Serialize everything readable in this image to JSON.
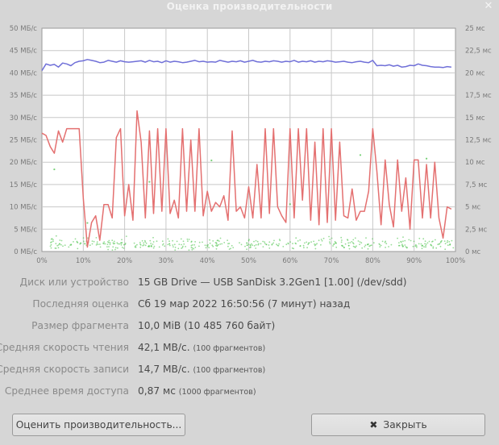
{
  "window": {
    "title": "Оценка производительности",
    "close_glyph": "✕"
  },
  "chart_data": {
    "type": "line",
    "x_ticks": [
      "0%",
      "10%",
      "20%",
      "30%",
      "40%",
      "50%",
      "60%",
      "70%",
      "80%",
      "90%",
      "100%"
    ],
    "y_left_ticks": [
      "0 МБ/с",
      "5 МБ/с",
      "10 МБ/с",
      "15 МБ/с",
      "20 МБ/с",
      "25 МБ/с",
      "30 МБ/с",
      "35 МБ/с",
      "40 МБ/с",
      "45 МБ/с",
      "50 МБ/с"
    ],
    "y_right_ticks": [
      "0 мс",
      "2,5 мс",
      "5 мс",
      "7,5 мс",
      "10 мс",
      "12,5 мс",
      "15 мс",
      "17,5 мс",
      "20 мс",
      "22,5 мс",
      "25 мс"
    ],
    "x_range": [
      0,
      100
    ],
    "y_left_range": [
      0,
      50
    ],
    "y_right_range": [
      0,
      25
    ],
    "grid": true,
    "colors": {
      "read": "#7070d8",
      "write": "#e47070",
      "access": "#3fbf3f",
      "grid": "#c8c8c8",
      "plot_bg": "#ffffff"
    },
    "series": [
      {
        "key": "read",
        "x": [
          0,
          1,
          2,
          3,
          4,
          5,
          6,
          7,
          8,
          9,
          10,
          11,
          12,
          13,
          14,
          15,
          16,
          17,
          18,
          19,
          20,
          21,
          22,
          23,
          24,
          25,
          26,
          27,
          28,
          29,
          30,
          31,
          32,
          33,
          34,
          35,
          36,
          37,
          38,
          39,
          40,
          41,
          42,
          43,
          44,
          45,
          46,
          47,
          48,
          49,
          50,
          51,
          52,
          53,
          54,
          55,
          56,
          57,
          58,
          59,
          60,
          61,
          62,
          63,
          64,
          65,
          66,
          67,
          68,
          69,
          70,
          71,
          72,
          73,
          74,
          75,
          76,
          77,
          78,
          79,
          80,
          81,
          82,
          83,
          84,
          85,
          86,
          87,
          88,
          89,
          90,
          91,
          92,
          93,
          94,
          95,
          96,
          97,
          98,
          99
        ],
        "values": [
          40.5,
          42.0,
          41.7,
          41.9,
          41.3,
          42.2,
          42.0,
          41.6,
          42.3,
          42.6,
          42.7,
          43.0,
          42.8,
          42.6,
          42.3,
          42.4,
          42.8,
          42.6,
          42.4,
          42.7,
          42.5,
          42.4,
          42.5,
          42.6,
          42.7,
          42.4,
          42.8,
          42.5,
          42.6,
          42.3,
          42.7,
          42.4,
          42.6,
          42.5,
          42.3,
          42.4,
          42.6,
          42.8,
          42.5,
          42.6,
          42.4,
          42.5,
          42.4,
          42.8,
          42.6,
          42.4,
          42.6,
          42.5,
          42.7,
          42.4,
          42.6,
          42.8,
          42.5,
          42.4,
          42.6,
          42.5,
          42.7,
          42.6,
          42.4,
          42.6,
          42.5,
          42.8,
          42.4,
          42.6,
          42.5,
          42.7,
          42.4,
          42.6,
          42.5,
          42.7,
          42.6,
          42.4,
          42.5,
          42.6,
          42.4,
          42.3,
          42.5,
          42.6,
          42.4,
          42.3,
          42.8,
          41.6,
          41.7,
          41.6,
          41.8,
          41.5,
          41.7,
          41.3,
          41.4,
          41.7,
          41.6,
          42.0,
          41.7,
          41.6,
          41.4,
          41.3,
          41.3,
          41.2,
          41.4,
          41.3
        ]
      },
      {
        "key": "write",
        "x": [
          0,
          1,
          2,
          3,
          4,
          5,
          6,
          7,
          8,
          9,
          10,
          11,
          12,
          13,
          14,
          15,
          16,
          17,
          18,
          19,
          20,
          21,
          22,
          23,
          24,
          25,
          26,
          27,
          28,
          29,
          30,
          31,
          32,
          33,
          34,
          35,
          36,
          37,
          38,
          39,
          40,
          41,
          42,
          43,
          44,
          45,
          46,
          47,
          48,
          49,
          50,
          51,
          52,
          53,
          54,
          55,
          56,
          57,
          58,
          59,
          60,
          61,
          62,
          63,
          64,
          65,
          66,
          67,
          68,
          69,
          70,
          71,
          72,
          73,
          74,
          75,
          76,
          77,
          78,
          79,
          80,
          81,
          82,
          83,
          84,
          85,
          86,
          87,
          88,
          89,
          90,
          91,
          92,
          93,
          94,
          95,
          96,
          97,
          98,
          99
        ],
        "values": [
          26.5,
          26.0,
          23.5,
          22.0,
          27.0,
          24.5,
          27.5,
          27.5,
          27.5,
          27.5,
          12.0,
          1.0,
          6.5,
          8.0,
          2.5,
          10.5,
          10.5,
          7.5,
          25.5,
          27.5,
          8.0,
          15.0,
          7.0,
          31.5,
          24.5,
          7.5,
          27.0,
          8.5,
          27.5,
          9.0,
          27.5,
          8.5,
          11.5,
          7.5,
          27.5,
          9.0,
          25.0,
          9.0,
          27.5,
          8.0,
          13.5,
          9.0,
          11.0,
          10.0,
          12.5,
          7.0,
          27.0,
          9.0,
          10.0,
          7.5,
          14.5,
          7.5,
          19.5,
          7.5,
          27.5,
          8.5,
          27.5,
          10.0,
          8.0,
          6.5,
          27.5,
          7.5,
          27.5,
          11.5,
          27.5,
          7.0,
          24.5,
          6.0,
          27.5,
          6.5,
          27.5,
          7.0,
          24.5,
          8.0,
          7.5,
          14.0,
          7.0,
          9.0,
          9.0,
          13.5,
          27.5,
          18.0,
          6.0,
          20.5,
          10.5,
          5.5,
          20.5,
          9.0,
          16.5,
          5.0,
          20.5,
          20.5,
          7.5,
          19.5,
          7.5,
          20.0,
          7.5,
          3.0,
          10.0,
          9.5
        ]
      },
      {
        "key": "access",
        "values": [
          0.8,
          0.9,
          0.7,
          1.1,
          0.6,
          0.9,
          0.8,
          1.2,
          0.7,
          0.9,
          1.0,
          0.8,
          0.6,
          1.3,
          0.9,
          0.7,
          1.0,
          0.8,
          1.1,
          0.7
        ]
      }
    ]
  },
  "info": {
    "rows": [
      {
        "label": "Диск или устройство",
        "value": "15 GB Drive — USB SanDisk 3.2Gen1 [1.00] (/dev/sdd)",
        "sub": ""
      },
      {
        "label": "Последняя оценка",
        "value": "Сб 19 мар 2022 16:50:56 (7 минут) назад",
        "sub": ""
      },
      {
        "label": "Размер фрагмента",
        "value": "10,0 MiB (10 485 760 байт)",
        "sub": ""
      },
      {
        "label": "Средняя скорость чтения",
        "value": "42,1 MB/с.",
        "sub": "(100 фрагментов)"
      },
      {
        "label": "Средняя скорость записи",
        "value": "14,7 MB/с.",
        "sub": "(100 фрагментов)"
      },
      {
        "label": "Среднее время доступа",
        "value": "0,87 мс",
        "sub": "(1000 фрагментов)"
      }
    ]
  },
  "buttons": {
    "benchmark_label": "Оценить производительность...",
    "close_label": "Закрыть",
    "close_icon": "✖"
  }
}
